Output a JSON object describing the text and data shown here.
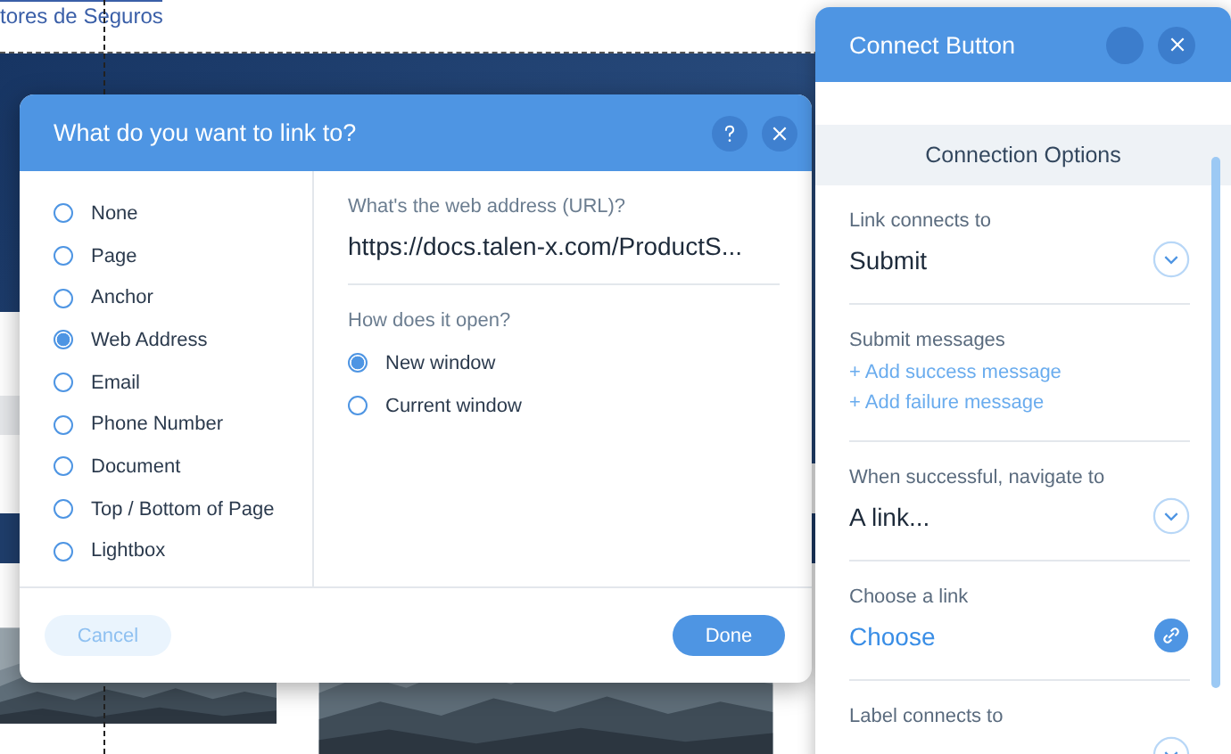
{
  "background": {
    "heading_link": "tores de Seguros"
  },
  "link_dialog": {
    "title": "What do you want to link to?",
    "link_types": [
      {
        "label": "None",
        "selected": false
      },
      {
        "label": "Page",
        "selected": false
      },
      {
        "label": "Anchor",
        "selected": false
      },
      {
        "label": "Web Address",
        "selected": true
      },
      {
        "label": "Email",
        "selected": false
      },
      {
        "label": "Phone Number",
        "selected": false
      },
      {
        "label": "Document",
        "selected": false
      },
      {
        "label": "Top / Bottom of Page",
        "selected": false
      },
      {
        "label": "Lightbox",
        "selected": false
      }
    ],
    "url_label": "What's the web address (URL)?",
    "url": "https://docs.talen-x.com/ProductS...",
    "open_label": "How does it open?",
    "open_options": [
      {
        "label": "New window",
        "selected": true
      },
      {
        "label": "Current window",
        "selected": false
      }
    ],
    "cancel": "Cancel",
    "done": "Done"
  },
  "connect_panel": {
    "title": "Connect Button",
    "section_title": "Connection Options",
    "fields": [
      {
        "kind": "dropdown",
        "label": "Link connects to",
        "value": "Submit"
      },
      {
        "kind": "links",
        "label": "Submit messages",
        "links": [
          "+ Add success message",
          "+ Add failure message"
        ]
      },
      {
        "kind": "dropdown",
        "label": "When successful, navigate to",
        "value": "A link..."
      },
      {
        "kind": "link_picker",
        "label": "Choose a link",
        "value": "Choose"
      },
      {
        "kind": "dropdown",
        "label": "Label connects to"
      }
    ]
  }
}
